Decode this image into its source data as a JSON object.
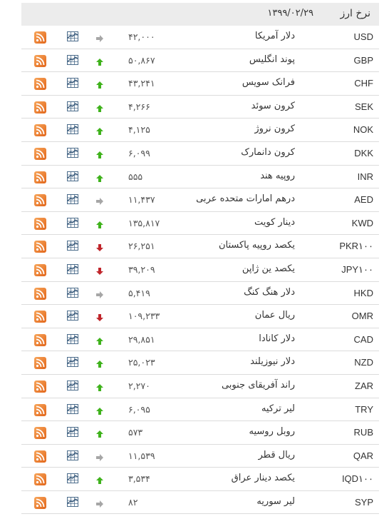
{
  "header": {
    "title": "نرخ ارز",
    "date": "۱۳۹۹/۰۲/۲۹"
  },
  "colors": {
    "up": "#3fb21c",
    "down": "#c0252b",
    "neutral": "#a6a6a6",
    "rss": "#e9772b",
    "header_bg": "#ececec"
  },
  "rows": [
    {
      "code": "USD",
      "name": "دلار آمریکا",
      "price": "۴۲,۰۰۰",
      "trend": "neutral"
    },
    {
      "code": "GBP",
      "name": "پوند انگلیس",
      "price": "۵۰,۸۶۷",
      "trend": "up"
    },
    {
      "code": "CHF",
      "name": "فرانک سویس",
      "price": "۴۳,۲۴۱",
      "trend": "up"
    },
    {
      "code": "SEK",
      "name": "کرون سوئد",
      "price": "۴,۲۶۶",
      "trend": "up"
    },
    {
      "code": "NOK",
      "name": "کرون نروژ",
      "price": "۴,۱۲۵",
      "trend": "up"
    },
    {
      "code": "DKK",
      "name": "کرون دانمارک",
      "price": "۶,۰۹۹",
      "trend": "up"
    },
    {
      "code": "INR",
      "name": "روپیه هند",
      "price": "۵۵۵",
      "trend": "up"
    },
    {
      "code": "AED",
      "name": "درهم امارات متحده عربی",
      "price": "۱۱,۴۳۷",
      "trend": "neutral"
    },
    {
      "code": "KWD",
      "name": "دینار کویت",
      "price": "۱۳۵,۸۱۷",
      "trend": "up"
    },
    {
      "code": "PKR۱۰۰",
      "name": "یکصد روپیه پاکستان",
      "price": "۲۶,۲۵۱",
      "trend": "down"
    },
    {
      "code": "JPY۱۰۰",
      "name": "یکصد ین ژاپن",
      "price": "۳۹,۲۰۹",
      "trend": "down"
    },
    {
      "code": "HKD",
      "name": "دلار هنگ کنگ",
      "price": "۵,۴۱۹",
      "trend": "neutral"
    },
    {
      "code": "OMR",
      "name": "ریال عمان",
      "price": "۱۰۹,۲۳۳",
      "trend": "down"
    },
    {
      "code": "CAD",
      "name": "دلار کانادا",
      "price": "۲۹,۸۵۱",
      "trend": "up"
    },
    {
      "code": "NZD",
      "name": "دلار نیوزیلند",
      "price": "۲۵,۰۲۳",
      "trend": "up"
    },
    {
      "code": "ZAR",
      "name": "راند آفریقای جنوبی",
      "price": "۲,۲۷۰",
      "trend": "up"
    },
    {
      "code": "TRY",
      "name": "لیر ترکیه",
      "price": "۶,۰۹۵",
      "trend": "up"
    },
    {
      "code": "RUB",
      "name": "روبل روسیه",
      "price": "۵۷۳",
      "trend": "up"
    },
    {
      "code": "QAR",
      "name": "ریال قطر",
      "price": "۱۱,۵۳۹",
      "trend": "neutral"
    },
    {
      "code": "IQD۱۰۰",
      "name": "یکصد دینار عراق",
      "price": "۳,۵۳۴",
      "trend": "up"
    },
    {
      "code": "SYP",
      "name": "لیر سوریه",
      "price": "۸۲",
      "trend": "neutral"
    }
  ]
}
